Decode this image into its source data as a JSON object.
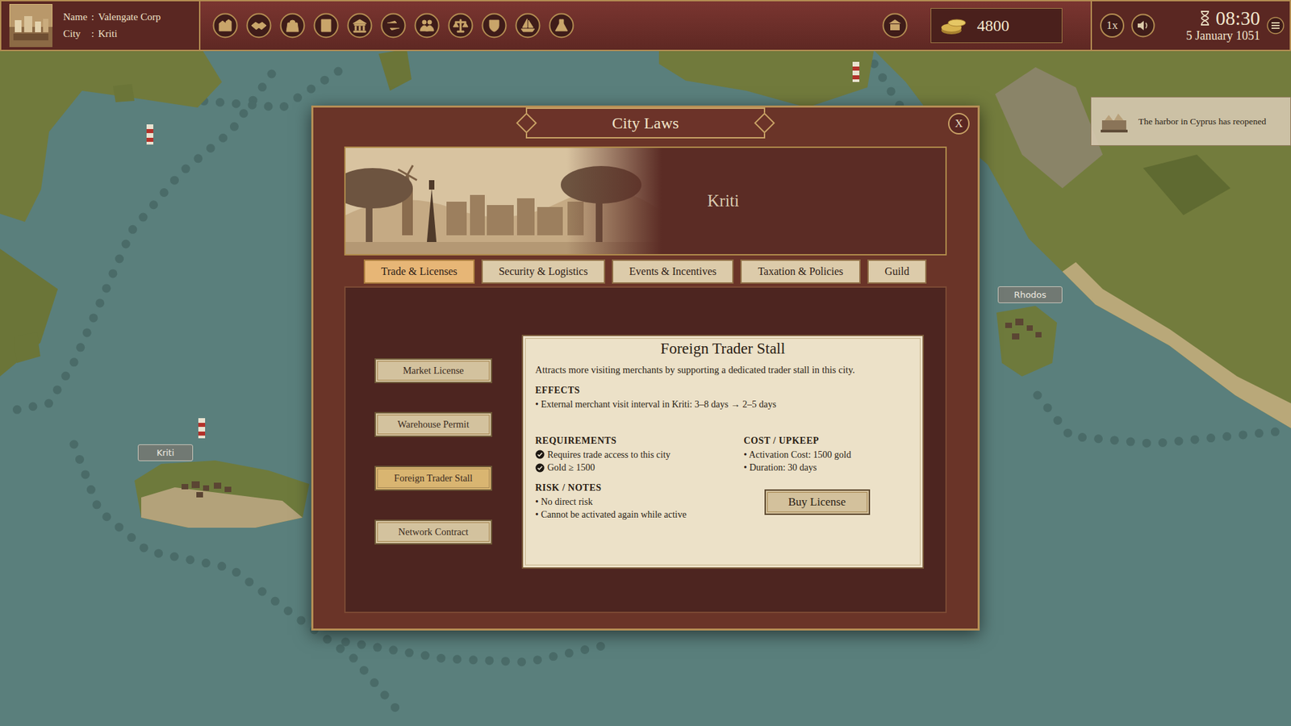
{
  "profile": {
    "fields": [
      {
        "label": "Name",
        "separator": ":",
        "value": "Valengate Corp"
      },
      {
        "label": "City",
        "separator": ":",
        "value": "Kriti"
      }
    ]
  },
  "resources": {
    "gold": "4800"
  },
  "clock": {
    "speed": "1x",
    "time": "08:30",
    "date": "5 January 1051"
  },
  "notification": {
    "text": "The harbor in Cyprus has reopened"
  },
  "map": {
    "cities": [
      {
        "name": "Kriti"
      },
      {
        "name": "Rhodos"
      }
    ]
  },
  "dialog": {
    "title": "City Laws",
    "close": "X",
    "city": "Kriti",
    "tabs": [
      {
        "label": "Trade & Licenses",
        "selected": true
      },
      {
        "label": "Security & Logistics",
        "selected": false
      },
      {
        "label": "Events & Incentives",
        "selected": false
      },
      {
        "label": "Taxation & Policies",
        "selected": false
      },
      {
        "label": "Guild",
        "selected": false
      }
    ],
    "laws": [
      {
        "label": "Market License",
        "selected": false
      },
      {
        "label": "Warehouse Permit",
        "selected": false
      },
      {
        "label": "Foreign Trader Stall",
        "selected": true
      },
      {
        "label": "Network Contract",
        "selected": false
      }
    ],
    "detail": {
      "title": "Foreign Trader Stall",
      "description": "Attracts more visiting merchants by supporting a dedicated trader stall in this city.",
      "effects": {
        "heading": "EFFECTS",
        "items": [
          "• External merchant visit interval in Kriti: 3–8 days → 2–5 days"
        ]
      },
      "requirements": {
        "heading": "REQUIREMENTS",
        "items": [
          {
            "text": "Requires trade access to this city",
            "met": true
          },
          {
            "text": "Gold ≥ 1500",
            "met": true
          }
        ]
      },
      "cost": {
        "heading": "COST / UPKEEP",
        "items": [
          "• Activation Cost: 1500 gold",
          "• Duration: 30 days"
        ]
      },
      "notes": {
        "heading": "RISK / NOTES",
        "items": [
          "• No direct risk",
          "• Cannot be activated again while active"
        ]
      },
      "action": "Buy License"
    }
  }
}
